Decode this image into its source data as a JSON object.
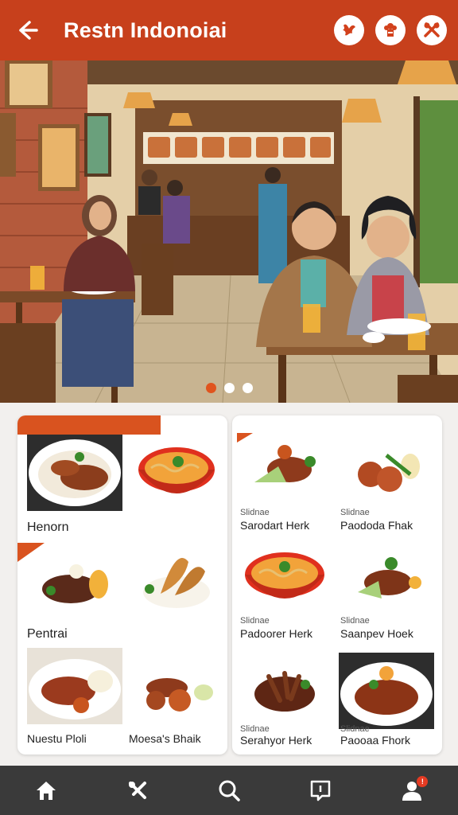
{
  "header": {
    "title": "Restn Indonoiai"
  },
  "hero": {
    "slides": 3,
    "active_slide": 1
  },
  "left_panel": {
    "labels": [
      "Henorn",
      "Pentrai",
      "Nuestu Ploli",
      "Moesa's Bhaik"
    ]
  },
  "right_panel": {
    "items": [
      {
        "sub": "Slidnae",
        "name": "Sarodart Herk"
      },
      {
        "sub": "Slidnae",
        "name": "Paododa Fhak"
      },
      {
        "sub": "Slidnae",
        "name": "Padoorer Herk"
      },
      {
        "sub": "Slidnae",
        "name": "Saanpev Hoek"
      },
      {
        "sub": "Slidnae",
        "name": "Serahyor Herk"
      },
      {
        "sub": "Slidnae",
        "name": "Paooaa Fhork"
      }
    ]
  },
  "nav": {
    "profile_badge": "!"
  },
  "colors": {
    "brand": "#c7401c",
    "accent": "#e0541e",
    "nav_bg": "#3a3a3a"
  }
}
